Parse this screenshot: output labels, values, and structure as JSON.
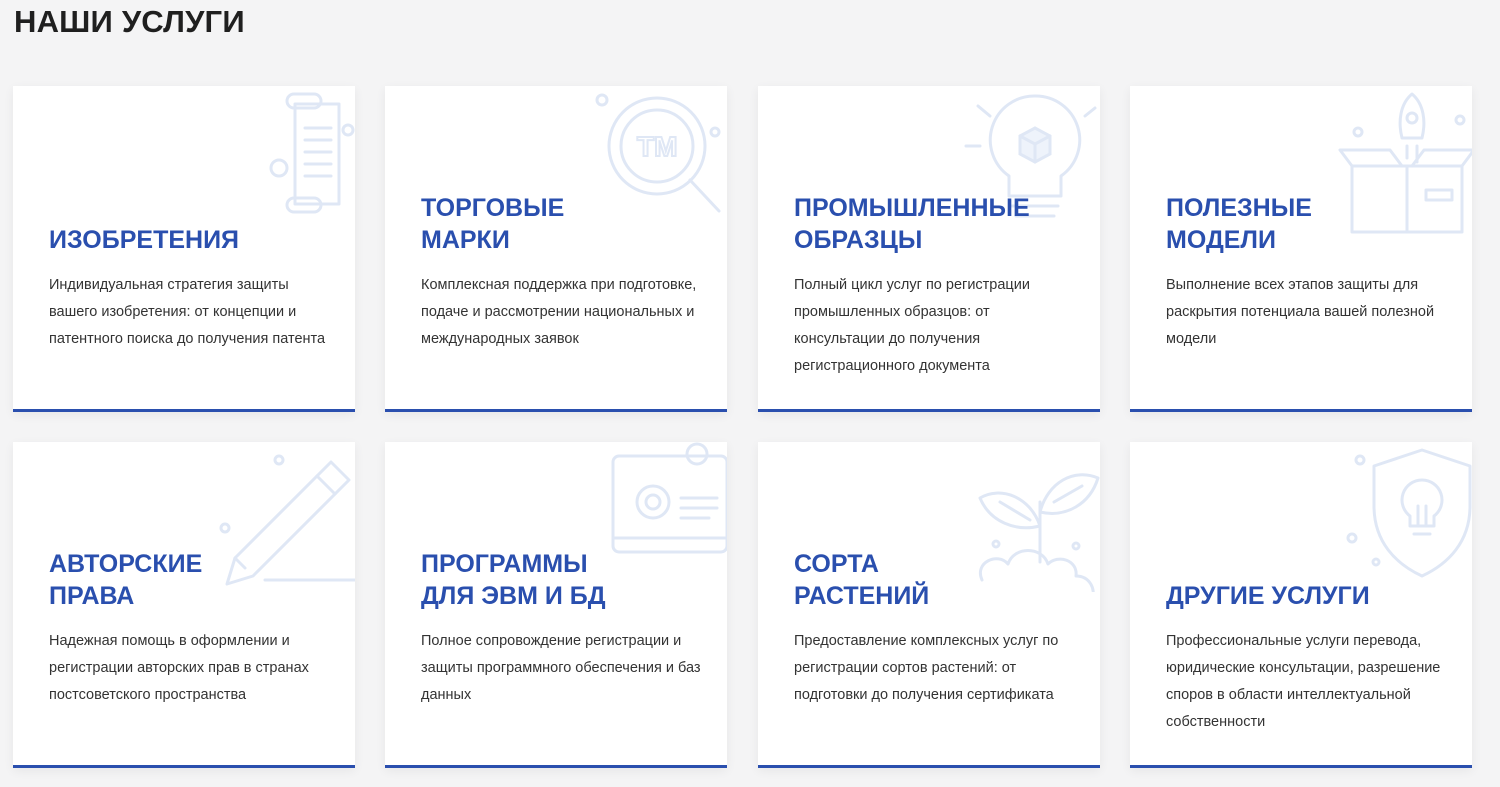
{
  "section": {
    "title": "НАШИ УСЛУГИ"
  },
  "services": [
    {
      "title": "Изобретения",
      "icon": "scroll-icon",
      "description": "Индивидуальная стратегия защиты вашего изобретения: от концепции и патентного поиска до получения патента"
    },
    {
      "title": "Торговые\nмарки",
      "icon": "trademark-magnifier-icon",
      "description": "Комплексная поддержка при подготовке, подаче и рассмотрении национальных и международных заявок"
    },
    {
      "title": "Промышленные\nобразцы",
      "icon": "lightbulb-cube-icon",
      "description": "Полный цикл услуг по регистрации промышленных образцов: от консультации до получения регистрационного документа"
    },
    {
      "title": "Полезные\nмодели",
      "icon": "rocket-box-icon",
      "description": "Выполнение всех этапов защиты для раскрытия потенциала вашей полезной модели"
    },
    {
      "title": "Авторские\nправа",
      "icon": "pencil-icon",
      "description": "Надежная помощь в оформлении и регистрации авторских прав в странах постсоветского пространства"
    },
    {
      "title": "Программы\nдля ЭВМ и БД",
      "icon": "computer-gear-icon",
      "description": "Полное сопровождение регистрации и защиты программного обеспечения и баз данных"
    },
    {
      "title": "Сорта\nрастений",
      "icon": "plant-sprout-icon",
      "description": "Предоставление комплексных услуг по регистрации сортов растений: от подготовки до получения сертификата"
    },
    {
      "title": "Другие услуги",
      "icon": "shield-bulb-icon",
      "description": "Профессиональные услуги перевода, юридические консультации, разрешение споров в области интеллектуальной собственности"
    }
  ],
  "colors": {
    "accent": "#2a4fae",
    "background": "#f4f4f5",
    "illustration": "#dfe7f5"
  }
}
